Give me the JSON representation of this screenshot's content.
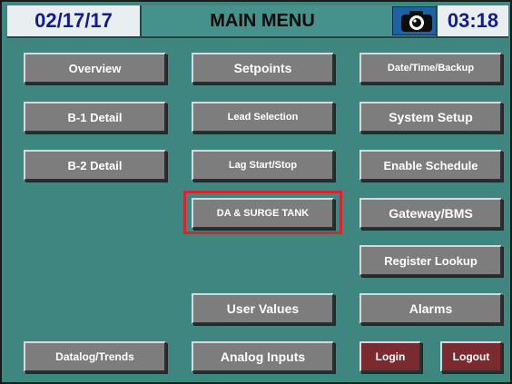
{
  "header": {
    "date": "02/17/17",
    "title": "MAIN MENU",
    "time": "03:18",
    "camera_icon": "camera-icon"
  },
  "menu": {
    "overview": "Overview",
    "b1_detail": "B-1 Detail",
    "b2_detail": "B-2 Detail",
    "datalog_trends": "Datalog/Trends",
    "setpoints": "Setpoints",
    "lead_selection": "Lead Selection",
    "lag_start_stop": "Lag Start/Stop",
    "da_surge_tank": "DA & SURGE TANK",
    "user_values": "User Values",
    "analog_inputs": "Analog Inputs",
    "date_time_backup": "Date/Time/Backup",
    "system_setup": "System Setup",
    "enable_schedule": "Enable Schedule",
    "gateway_bms": "Gateway/BMS",
    "register_lookup": "Register Lookup",
    "alarms": "Alarms",
    "login": "Login",
    "logout": "Logout"
  },
  "colors": {
    "background": "#3f8580",
    "button": "#7d7d7d",
    "login_logout": "#7b2a2f",
    "highlight": "#d3262e",
    "header_text": "#151d8c"
  }
}
